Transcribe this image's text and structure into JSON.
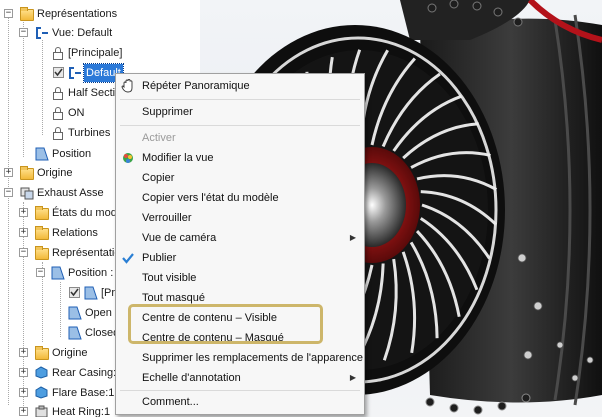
{
  "browser": {
    "items": [
      {
        "label": "Représentations"
      },
      {
        "label": "Vue: Default"
      },
      {
        "label": "[Principale]"
      },
      {
        "label": "Default"
      },
      {
        "label": "Half Secti"
      },
      {
        "label": "ON"
      },
      {
        "label": "Turbines"
      },
      {
        "label": "Position"
      },
      {
        "label": "Origine"
      },
      {
        "label": "Exhaust Asse"
      },
      {
        "label": "États du mod"
      },
      {
        "label": "Relations"
      },
      {
        "label": "Représentation"
      },
      {
        "label": "Position :"
      },
      {
        "label": "[Pri"
      },
      {
        "label": "Open"
      },
      {
        "label": "Closed"
      },
      {
        "label": "Origine"
      },
      {
        "label": "Rear Casing:"
      },
      {
        "label": "Flare Base:1"
      },
      {
        "label": "Heat Ring:1"
      }
    ]
  },
  "context_menu": {
    "items": [
      {
        "label": "Répéter Panoramique"
      },
      {
        "label": "Supprimer"
      },
      {
        "label": "Activer"
      },
      {
        "label": "Modifier la vue"
      },
      {
        "label": "Copier"
      },
      {
        "label": "Copier vers l'état du modèle"
      },
      {
        "label": "Verrouiller"
      },
      {
        "label": "Vue de caméra"
      },
      {
        "label": "Publier"
      },
      {
        "label": "Tout visible"
      },
      {
        "label": "Tout masqué"
      },
      {
        "label": "Centre de contenu – Visible"
      },
      {
        "label": "Centre de contenu – Masqué"
      },
      {
        "label": "Supprimer les remplacements de l'apparence"
      },
      {
        "label": "Echelle d'annotation"
      },
      {
        "label": "Comment..."
      }
    ]
  },
  "colors": {
    "selection": "#2b79d8",
    "highlight_frame": "#cdb66a",
    "engine_red": "#b3121a",
    "check_mark": "#2a7fd4"
  }
}
